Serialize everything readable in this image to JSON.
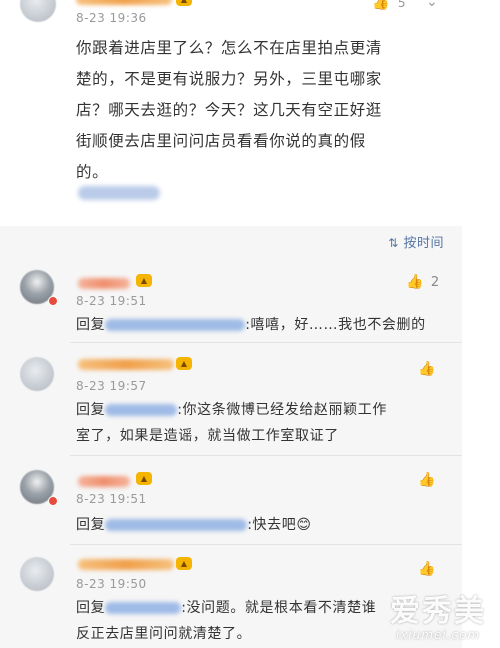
{
  "top_comment": {
    "timestamp": "8-23 19:36",
    "likes": "5",
    "text_lines": [
      "你跟着进店里了么？怎么不在店里拍点更清",
      "楚的，不是更有说服力？另外，三里屯哪家",
      "店？哪天去逛的？今天？这几天有空正好逛",
      "街顺便去店里问问店员看看你说的真的假",
      "的。"
    ]
  },
  "sort": {
    "label": "按时间"
  },
  "replies": [
    {
      "timestamp": "8-23 19:51",
      "likes": "2",
      "prefix": "回复",
      "text": ":嘻嘻，好……我也不会删的"
    },
    {
      "timestamp": "8-23 19:57",
      "likes": "",
      "prefix": "回复",
      "text_line1": ":你这条微博已经发给赵丽颖工作",
      "text_line2": "室了，如果是造谣，就当做工作室取证了"
    },
    {
      "timestamp": "8-23 19:51",
      "likes": "",
      "prefix": "回复",
      "text": ":快去吧😊"
    },
    {
      "timestamp": "8-23 19:50",
      "likes": "",
      "prefix": "回复",
      "text_line1": ":没问题。就是根本看不清楚谁",
      "text_line2": "反正去店里问问就清楚了。"
    }
  ],
  "watermark": {
    "main": "爱秀美",
    "sub": "ixiumei.com"
  }
}
